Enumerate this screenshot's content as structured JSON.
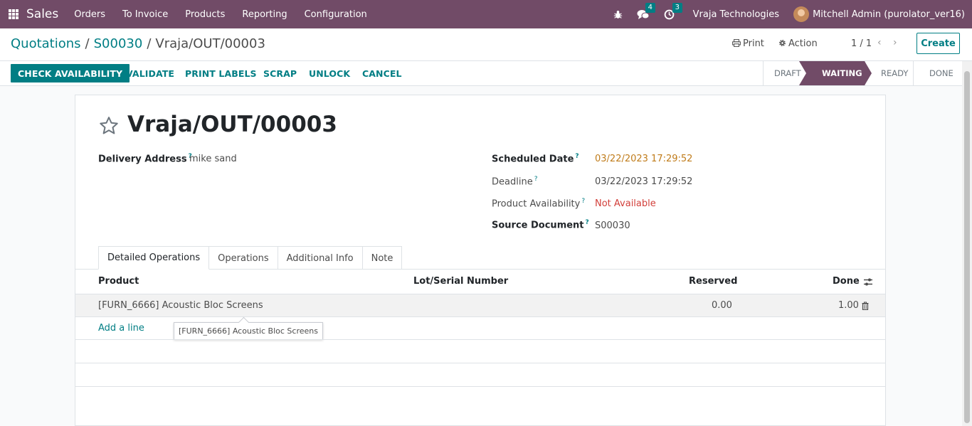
{
  "navbar": {
    "app_name": "Sales",
    "menu": [
      "Orders",
      "To Invoice",
      "Products",
      "Reporting",
      "Configuration"
    ],
    "messages_count": "4",
    "activities_count": "3",
    "company": "Vraja Technologies",
    "user": "Mitchell Admin (purolator_ver16)"
  },
  "breadcrumb": {
    "root": "Quotations",
    "parent": "S00030",
    "current": "Vraja/OUT/00003",
    "separator": "/"
  },
  "control": {
    "print_label": "Print",
    "action_label": "Action",
    "pager": "1 / 1",
    "create_label": "Create"
  },
  "statusbar": {
    "buttons": [
      "CHECK AVAILABILITY",
      "VALIDATE",
      "PRINT LABELS",
      "SCRAP",
      "UNLOCK",
      "CANCEL"
    ],
    "stages": [
      "DRAFT",
      "WAITING",
      "READY",
      "DONE"
    ],
    "active_stage": "WAITING"
  },
  "form": {
    "title": "Vraja/OUT/00003",
    "delivery_address_label": "Delivery Address",
    "delivery_address": "mike sand",
    "scheduled_date_label": "Scheduled Date",
    "scheduled_date": "03/22/2023 17:29:52",
    "deadline_label": "Deadline",
    "deadline": "03/22/2023 17:29:52",
    "availability_label": "Product Availability",
    "availability": "Not Available",
    "source_label": "Source Document",
    "source": "S00030",
    "help_mark": "?"
  },
  "tabs": [
    "Detailed Operations",
    "Operations",
    "Additional Info",
    "Note"
  ],
  "table": {
    "headers": {
      "product": "Product",
      "lot": "Lot/Serial Number",
      "reserved": "Reserved",
      "done": "Done"
    },
    "rows": [
      {
        "product": "[FURN_6666] Acoustic Bloc Screens",
        "lot": "",
        "reserved": "0.00",
        "done": "1.00"
      }
    ],
    "add_line": "Add a line",
    "tooltip": "[FURN_6666] Acoustic Bloc Screens"
  },
  "colors": {
    "brand": "#714b67",
    "accent": "#017e84",
    "warning": "#c07c1b",
    "danger": "#d23f3a"
  }
}
